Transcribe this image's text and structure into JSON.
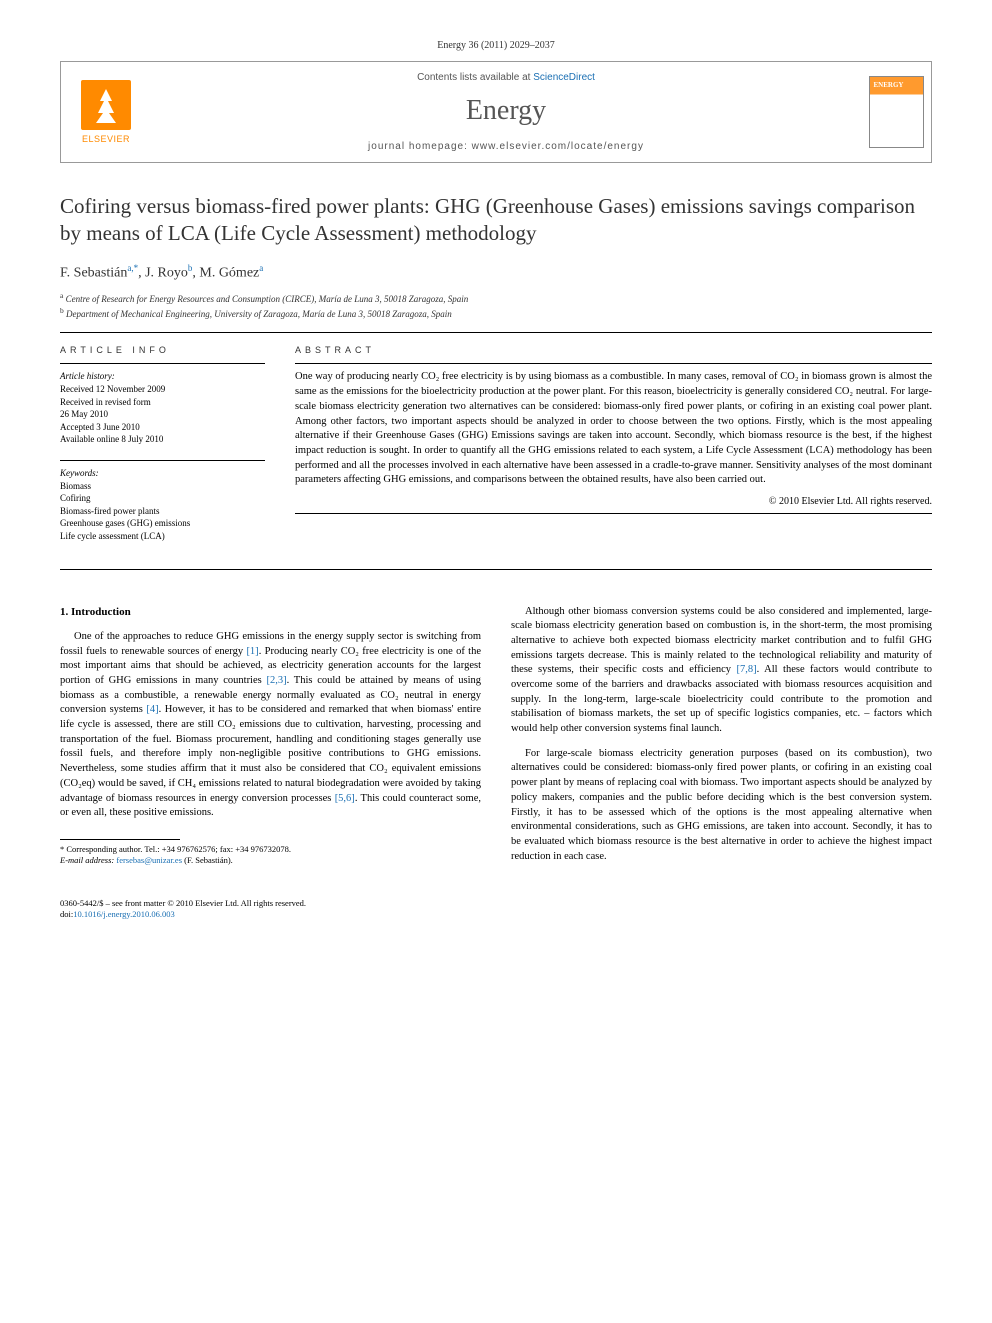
{
  "citation": "Energy 36 (2011) 2029–2037",
  "header": {
    "contents_prefix": "Contents lists available at ",
    "contents_link": "ScienceDirect",
    "journal": "Energy",
    "homepage_prefix": "journal homepage: ",
    "homepage_url": "www.elsevier.com/locate/energy",
    "publisher": "ELSEVIER",
    "cover_label": "ENERGY"
  },
  "title": "Cofiring versus biomass-fired power plants: GHG (Greenhouse Gases) emissions savings comparison by means of LCA (Life Cycle Assessment) methodology",
  "authors_html": "F. Sebastián",
  "authors": [
    {
      "name": "F. Sebastián",
      "affil": "a,*"
    },
    {
      "name": "J. Royo",
      "affil": "b"
    },
    {
      "name": "M. Gómez",
      "affil": "a"
    }
  ],
  "affiliations": [
    {
      "sup": "a",
      "text": "Centre of Research for Energy Resources and Consumption (CIRCE), María de Luna 3, 50018 Zaragoza, Spain"
    },
    {
      "sup": "b",
      "text": "Department of Mechanical Engineering, University of Zaragoza, María de Luna 3, 50018 Zaragoza, Spain"
    }
  ],
  "article_info_head": "ARTICLE INFO",
  "abstract_head": "ABSTRACT",
  "history_label": "Article history:",
  "history": [
    "Received 12 November 2009",
    "Received in revised form",
    "26 May 2010",
    "Accepted 3 June 2010",
    "Available online 8 July 2010"
  ],
  "keywords_label": "Keywords:",
  "keywords": [
    "Biomass",
    "Cofiring",
    "Biomass-fired power plants",
    "Greenhouse gases (GHG) emissions",
    "Life cycle assessment (LCA)"
  ],
  "abstract": "One way of producing nearly CO₂ free electricity is by using biomass as a combustible. In many cases, removal of CO₂ in biomass grown is almost the same as the emissions for the bioelectricity production at the power plant. For this reason, bioelectricity is generally considered CO₂ neutral. For large-scale biomass electricity generation two alternatives can be considered: biomass-only fired power plants, or cofiring in an existing coal power plant. Among other factors, two important aspects should be analyzed in order to choose between the two options. Firstly, which is the most appealing alternative if their Greenhouse Gases (GHG) Emissions savings are taken into account. Secondly, which biomass resource is the best, if the highest impact reduction is sought. In order to quantify all the GHG emissions related to each system, a Life Cycle Assessment (LCA) methodology has been performed and all the processes involved in each alternative have been assessed in a cradle-to-grave manner. Sensitivity analyses of the most dominant parameters affecting GHG emissions, and comparisons between the obtained results, have also been carried out.",
  "copyright": "© 2010 Elsevier Ltd. All rights reserved.",
  "intro_heading": "1. Introduction",
  "body": {
    "p1a": "One of the approaches to reduce GHG emissions in the energy supply sector is switching from fossil fuels to renewable sources of energy ",
    "r1": "[1]",
    "p1b": ". Producing nearly CO₂ free electricity is one of the most important aims that should be achieved, as electricity generation accounts for the largest portion of GHG emissions in many countries ",
    "r23": "[2,3]",
    "p1c": ". This could be attained by means of using biomass as a combustible, a renewable energy normally evaluated as CO₂ neutral in energy conversion systems ",
    "r4": "[4]",
    "p1d": ". However, it has to be considered and remarked that when biomass' entire life cycle is assessed, there are still CO₂ emissions due to cultivation, harvesting, processing and transportation of the fuel. Biomass procurement, handling and conditioning stages generally use fossil fuels, and therefore imply non-negligible positive contributions to GHG emissions. Nevertheless, some studies affirm that it must also be considered that CO₂ equivalent emissions (CO₂eq) would be saved, if CH₄ emissions related to natural biodegradation were avoided by taking advantage of biomass resources in energy conversion processes ",
    "r56": "[5,6]",
    "p1e": ". This could counteract some, or even all, these positive emissions.",
    "p2a": "Although other biomass conversion systems could be also considered and implemented, large-scale biomass electricity generation based on combustion is, in the short-term, the most promising alternative to achieve both expected biomass electricity market contribution and to fulfil GHG emissions targets decrease. This is mainly related to the technological reliability and maturity of these systems, their specific costs and efficiency ",
    "r78": "[7,8]",
    "p2b": ". All these factors would contribute to overcome some of the barriers and drawbacks associated with biomass resources acquisition and supply. In the long-term, large-scale bioelectricity could contribute to the promotion and stabilisation of biomass markets, the set up of specific logistics companies, etc. – factors which would help other conversion systems final launch.",
    "p3": "For large-scale biomass electricity generation purposes (based on its combustion), two alternatives could be considered: biomass-only fired power plants, or cofiring in an existing coal power plant by means of replacing coal with biomass. Two important aspects should be analyzed by policy makers, companies and the public before deciding which is the best conversion system. Firstly, it has to be assessed which of the options is the most appealing alternative when environmental considerations, such as GHG emissions, are taken into account. Secondly, it has to be evaluated which biomass resource is the best alternative in order to achieve the highest impact reduction in each case."
  },
  "corresponding": {
    "label": "* Corresponding author. Tel.: +34 976762576; fax: +34 976732078.",
    "email_label": "E-mail address: ",
    "email": "fersebas@unizar.es",
    "email_suffix": " (F. Sebastián)."
  },
  "footer": {
    "line1": "0360-5442/$ – see front matter © 2010 Elsevier Ltd. All rights reserved.",
    "doi_label": "doi:",
    "doi": "10.1016/j.energy.2010.06.003"
  }
}
